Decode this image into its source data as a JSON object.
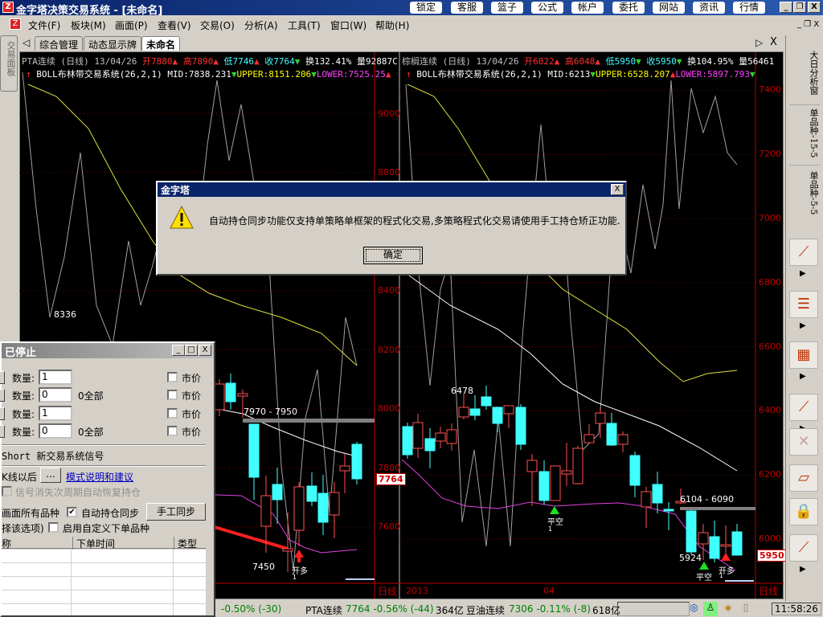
{
  "app": {
    "title": "金字塔决策交易系统 - [未命名]",
    "toolbar_buttons": [
      "锁定",
      "客服",
      "篮子",
      "公式",
      "帐户",
      "委托",
      "网站",
      "资讯",
      "行情"
    ]
  },
  "menu": [
    "文件(F)",
    "板块(M)",
    "画面(P)",
    "查看(V)",
    "交易(O)",
    "分析(A)",
    "工具(T)",
    "窗口(W)",
    "帮助(H)"
  ],
  "tabs": [
    "综合管理",
    "动态显示牌",
    "未命名"
  ],
  "left_sidebar_label": "交易面板",
  "right_tabs": [
    "大日分析窗",
    "单品种-15-5",
    "单品种-5-5"
  ],
  "chart_left": {
    "name": "PTA连续",
    "period": "(日线)",
    "date": "13/04/26",
    "open": "开7880",
    "high": "高7890",
    "low": "低7746",
    "close": "收7764",
    "turnover": "换132.41%",
    "volume": "量92887C",
    "indicator": "BOLL布林带交易系统(26,2,1)",
    "mid": "MID:7838.231",
    "upper": "UPPER:8151.206",
    "lower": "LOWER:7525.25",
    "yticks": [
      "9000",
      "8800",
      "8400",
      "8200",
      "8000",
      "7800",
      "7600"
    ],
    "price_tag": "7764",
    "period_label": "日线",
    "notes": {
      "high_mark": "8336",
      "range": "7970 - 7950",
      "low_mark": "7450",
      "signal": "开多",
      "signal_qty": "1"
    }
  },
  "chart_right": {
    "name": "棕榈连续",
    "period": "(日线)",
    "date": "13/04/26",
    "open": "开6022",
    "high": "高6048",
    "low": "低5950",
    "close": "收5950",
    "turnover": "换104.95%",
    "volume": "量56461",
    "indicator": "BOLL布林带交易系统(26,2,1)",
    "mid": "MID:6213",
    "upper": "UPPER:6528.207",
    "lower": "LOWER:5897.793",
    "yticks": [
      "7400",
      "7200",
      "7000",
      "6800",
      "6600",
      "6400",
      "6200",
      "6000"
    ],
    "price_tag": "5950",
    "period_label": "日线",
    "xticks": [
      "2013",
      "04"
    ],
    "notes": {
      "high_mark": "6478",
      "range": "6104 - 6090",
      "low_mark": "5924",
      "signal1": "平空",
      "signal1_qty": "1",
      "signal2": "平空",
      "signal3": "开多",
      "signal3_qty": "1"
    }
  },
  "dialog": {
    "title": "金字塔",
    "message": "自动持仓同步功能仅支持单策略单框架的程式化交易,多策略程式化交易请使用手工持仓矫正功能.",
    "ok": "确定"
  },
  "panel": {
    "title": "已停止",
    "rows": [
      {
        "label": "数量:",
        "value": "1",
        "extra": "",
        "market": "市价"
      },
      {
        "label": "数量:",
        "value": "0",
        "extra": "0全部",
        "market": "市价"
      },
      {
        "label": "数量:",
        "value": "1",
        "extra": "",
        "market": "市价"
      },
      {
        "label": "数量:",
        "value": "0",
        "extra": "0全部",
        "market": "市价"
      }
    ],
    "system": "Short 新交易系统信号",
    "after_bar": "K线以后",
    "dots": "...",
    "mode_link": "模式说明和建议",
    "restore": "信号消失次周期自动恢复持仓",
    "all_symbols": "画面所有品种",
    "auto_sync": "自动持仓同步",
    "manual_sync": "手工同步",
    "select_hint": "择该选项)",
    "custom_symbol": "启用自定义下单品种",
    "columns": [
      "称",
      "下单时间",
      "类型"
    ]
  },
  "status": {
    "item0": "-0.50% (-30)",
    "item1_name": "PTA连续",
    "item1_val": "7764 -0.56% (-44)",
    "item1_amt": "364亿",
    "item2_name": "豆油连续",
    "item2_val": "7306 -0.11% (-8)",
    "item2_amt": "618亿",
    "time": "11:58:26"
  }
}
